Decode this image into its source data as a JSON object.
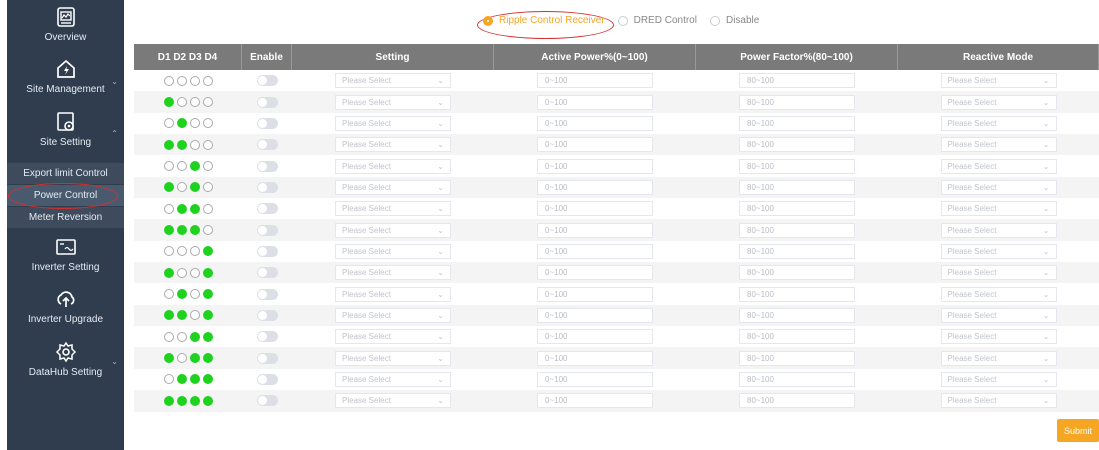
{
  "sidebar": {
    "items": [
      {
        "label": "Overview",
        "icon": "overview-icon"
      },
      {
        "label": "Site Management",
        "icon": "site-management-icon"
      },
      {
        "label": "Site Setting",
        "icon": "site-setting-icon"
      },
      {
        "label": "Inverter Setting",
        "icon": "inverter-setting-icon"
      },
      {
        "label": "Inverter Upgrade",
        "icon": "inverter-upgrade-icon"
      },
      {
        "label": "DataHub Setting",
        "icon": "datahub-setting-icon"
      }
    ],
    "sub_items": [
      {
        "label": "Export limit Control"
      },
      {
        "label": "Power Control",
        "active": true
      },
      {
        "label": "Meter Reversion"
      }
    ]
  },
  "mode": {
    "options": [
      {
        "label": "Ripple Control Receiver",
        "checked": true
      },
      {
        "label": "DRED Control",
        "checked": false
      },
      {
        "label": "Disable",
        "checked": false
      }
    ]
  },
  "table": {
    "headers": [
      "D1 D2 D3 D4",
      "Enable",
      "Setting",
      "Active Power%(0~100)",
      "Power Factor%(80~100)",
      "Reactive Mode"
    ],
    "select_placeholder": "Please Select",
    "active_power_placeholder": "0~100",
    "power_factor_placeholder": "80~100",
    "rows": [
      [
        0,
        0,
        0,
        0
      ],
      [
        1,
        0,
        0,
        0
      ],
      [
        0,
        1,
        0,
        0
      ],
      [
        1,
        1,
        0,
        0
      ],
      [
        0,
        0,
        1,
        0
      ],
      [
        1,
        0,
        1,
        0
      ],
      [
        0,
        1,
        1,
        0
      ],
      [
        1,
        1,
        1,
        0
      ],
      [
        0,
        0,
        0,
        1
      ],
      [
        1,
        0,
        0,
        1
      ],
      [
        0,
        1,
        0,
        1
      ],
      [
        1,
        1,
        0,
        1
      ],
      [
        0,
        0,
        1,
        1
      ],
      [
        1,
        0,
        1,
        1
      ],
      [
        0,
        1,
        1,
        1
      ],
      [
        1,
        1,
        1,
        1
      ]
    ]
  },
  "submit_label": "Submit",
  "colors": {
    "accent": "#f5a623",
    "dot_on": "#1fd21f",
    "sidebar": "#2f3d4f",
    "header": "#7a7a7a",
    "highlight_ring": "#d63030"
  }
}
